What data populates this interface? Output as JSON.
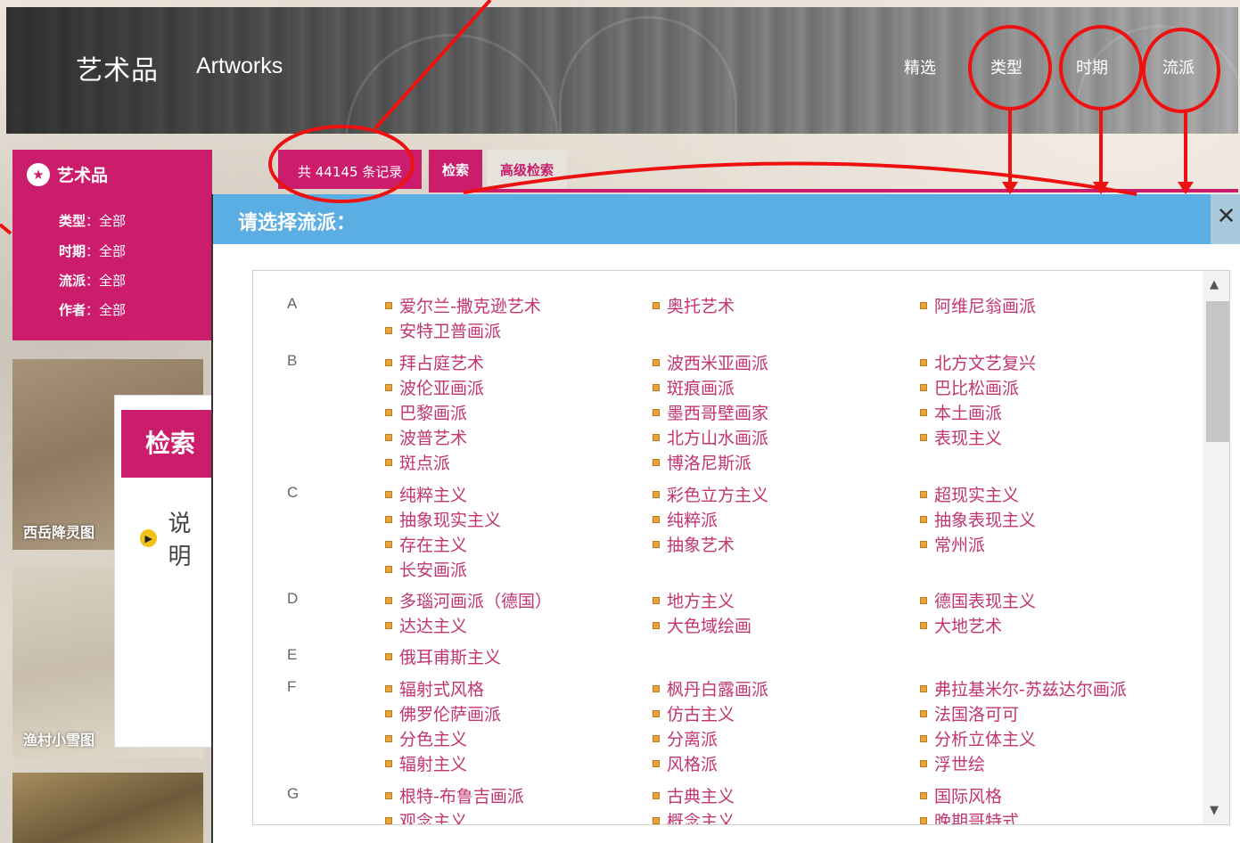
{
  "header": {
    "title": "艺术品",
    "title_en": "Artworks",
    "nav": [
      "精选",
      "类型",
      "时期",
      "流派"
    ]
  },
  "sidebar": {
    "title": "艺术品",
    "filters": [
      {
        "label": "类型",
        "value": "全部"
      },
      {
        "label": "时期",
        "value": "全部"
      },
      {
        "label": "流派",
        "value": "全部"
      },
      {
        "label": "作者",
        "value": "全部"
      }
    ]
  },
  "results": {
    "count_text": "共 44145 条记录",
    "tabs": [
      "检索",
      "高级检索"
    ]
  },
  "thumbnails": [
    "西岳降灵图",
    "渔村小雪图"
  ],
  "search_panel": {
    "title": "检索",
    "desc": "说明"
  },
  "modal": {
    "title": "请选择流派：",
    "close": "✕",
    "groups": [
      {
        "letter": "A",
        "items": [
          "爱尔兰-撒克逊艺术",
          "奥托艺术",
          "阿维尼翁画派",
          "安特卫普画派"
        ]
      },
      {
        "letter": "B",
        "items": [
          "拜占庭艺术",
          "波西米亚画派",
          "北方文艺复兴",
          "波伦亚画派",
          "斑痕画派",
          "巴比松画派",
          "巴黎画派",
          "墨西哥壁画家",
          "本土画派",
          "波普艺术",
          "北方山水画派",
          "表现主义",
          "斑点派",
          "博洛尼斯派"
        ]
      },
      {
        "letter": "C",
        "items": [
          "纯粹主义",
          "彩色立方主义",
          "超现实主义",
          "抽象现实主义",
          "纯粹派",
          "抽象表现主义",
          "存在主义",
          "抽象艺术",
          "常州派",
          "长安画派"
        ]
      },
      {
        "letter": "D",
        "items": [
          "多瑙河画派（德国）",
          "地方主义",
          "德国表现主义",
          "达达主义",
          "大色域绘画",
          "大地艺术"
        ]
      },
      {
        "letter": "E",
        "items": [
          "俄耳甫斯主义"
        ]
      },
      {
        "letter": "F",
        "items": [
          "辐射式风格",
          "枫丹白露画派",
          "弗拉基米尔-苏兹达尔画派",
          "佛罗伦萨画派",
          "仿古主义",
          "法国洛可可",
          "分色主义",
          "分离派",
          "分析立体主义",
          "辐射主义",
          "风格派",
          "浮世绘"
        ]
      },
      {
        "letter": "G",
        "items": [
          "根特-布鲁吉画派",
          "古典主义",
          "国际风格",
          "观念主义",
          "概念主义",
          "晚期哥特式"
        ]
      }
    ]
  },
  "colors": {
    "brand": "#cc1c6c",
    "modal_header": "#5aaee3",
    "link": "#c2356e",
    "annotation": "#ee1111"
  }
}
